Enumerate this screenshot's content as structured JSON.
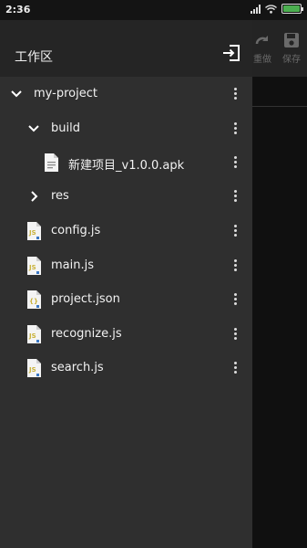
{
  "status_bar": {
    "time": "2:36",
    "battery_level": 1.0,
    "battery_color": "#4caf50"
  },
  "background_toolbar": {
    "redo_label": "重做",
    "save_label": "保存"
  },
  "drawer": {
    "title": "工作区",
    "exit_icon": "exit-to-app-icon",
    "items": [
      {
        "label": "my-project",
        "type": "folder",
        "expanded": true
      },
      {
        "label": "build",
        "type": "folder",
        "expanded": true
      },
      {
        "label": "新建项目_v1.0.0.apk",
        "type": "apk-file"
      },
      {
        "label": "res",
        "type": "folder",
        "expanded": false
      },
      {
        "label": "config.js",
        "type": "js-file"
      },
      {
        "label": "main.js",
        "type": "js-file"
      },
      {
        "label": "project.json",
        "type": "json-file"
      },
      {
        "label": "recognize.js",
        "type": "js-file"
      },
      {
        "label": "search.js",
        "type": "js-file"
      }
    ]
  },
  "colors": {
    "drawer_bg": "#2f2f2f",
    "header_bg": "#252525",
    "js_icon": "#c9b23a",
    "text": "#f2f2f2"
  }
}
